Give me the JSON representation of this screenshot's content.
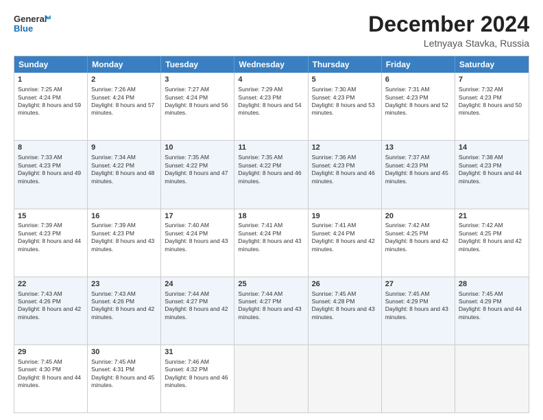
{
  "header": {
    "logo_line1": "General",
    "logo_line2": "Blue",
    "month": "December 2024",
    "location": "Letnyaya Stavka, Russia"
  },
  "weekdays": [
    "Sunday",
    "Monday",
    "Tuesday",
    "Wednesday",
    "Thursday",
    "Friday",
    "Saturday"
  ],
  "rows": [
    [
      {
        "day": "",
        "sunrise": "",
        "sunset": "",
        "daylight": "",
        "empty": true
      },
      {
        "day": "2",
        "sunrise": "Sunrise: 7:26 AM",
        "sunset": "Sunset: 4:24 PM",
        "daylight": "Daylight: 8 hours and 57 minutes."
      },
      {
        "day": "3",
        "sunrise": "Sunrise: 7:27 AM",
        "sunset": "Sunset: 4:24 PM",
        "daylight": "Daylight: 8 hours and 56 minutes."
      },
      {
        "day": "4",
        "sunrise": "Sunrise: 7:29 AM",
        "sunset": "Sunset: 4:23 PM",
        "daylight": "Daylight: 8 hours and 54 minutes."
      },
      {
        "day": "5",
        "sunrise": "Sunrise: 7:30 AM",
        "sunset": "Sunset: 4:23 PM",
        "daylight": "Daylight: 8 hours and 53 minutes."
      },
      {
        "day": "6",
        "sunrise": "Sunrise: 7:31 AM",
        "sunset": "Sunset: 4:23 PM",
        "daylight": "Daylight: 8 hours and 52 minutes."
      },
      {
        "day": "7",
        "sunrise": "Sunrise: 7:32 AM",
        "sunset": "Sunset: 4:23 PM",
        "daylight": "Daylight: 8 hours and 50 minutes."
      }
    ],
    [
      {
        "day": "1",
        "sunrise": "Sunrise: 7:25 AM",
        "sunset": "Sunset: 4:24 PM",
        "daylight": "Daylight: 8 hours and 59 minutes.",
        "first": true
      },
      {
        "day": "",
        "sunrise": "",
        "sunset": "",
        "daylight": "",
        "empty": true
      },
      {
        "day": "",
        "sunrise": "",
        "sunset": "",
        "daylight": "",
        "empty": true
      },
      {
        "day": "",
        "sunrise": "",
        "sunset": "",
        "daylight": "",
        "empty": true
      },
      {
        "day": "",
        "sunrise": "",
        "sunset": "",
        "daylight": "",
        "empty": true
      },
      {
        "day": "",
        "sunrise": "",
        "sunset": "",
        "daylight": "",
        "empty": true
      },
      {
        "day": "",
        "sunrise": "",
        "sunset": "",
        "daylight": "",
        "empty": true
      }
    ],
    [
      {
        "day": "8",
        "sunrise": "Sunrise: 7:33 AM",
        "sunset": "Sunset: 4:23 PM",
        "daylight": "Daylight: 8 hours and 49 minutes."
      },
      {
        "day": "9",
        "sunrise": "Sunrise: 7:34 AM",
        "sunset": "Sunset: 4:22 PM",
        "daylight": "Daylight: 8 hours and 48 minutes."
      },
      {
        "day": "10",
        "sunrise": "Sunrise: 7:35 AM",
        "sunset": "Sunset: 4:22 PM",
        "daylight": "Daylight: 8 hours and 47 minutes."
      },
      {
        "day": "11",
        "sunrise": "Sunrise: 7:35 AM",
        "sunset": "Sunset: 4:22 PM",
        "daylight": "Daylight: 8 hours and 46 minutes."
      },
      {
        "day": "12",
        "sunrise": "Sunrise: 7:36 AM",
        "sunset": "Sunset: 4:23 PM",
        "daylight": "Daylight: 8 hours and 46 minutes."
      },
      {
        "day": "13",
        "sunrise": "Sunrise: 7:37 AM",
        "sunset": "Sunset: 4:23 PM",
        "daylight": "Daylight: 8 hours and 45 minutes."
      },
      {
        "day": "14",
        "sunrise": "Sunrise: 7:38 AM",
        "sunset": "Sunset: 4:23 PM",
        "daylight": "Daylight: 8 hours and 44 minutes."
      }
    ],
    [
      {
        "day": "15",
        "sunrise": "Sunrise: 7:39 AM",
        "sunset": "Sunset: 4:23 PM",
        "daylight": "Daylight: 8 hours and 44 minutes."
      },
      {
        "day": "16",
        "sunrise": "Sunrise: 7:39 AM",
        "sunset": "Sunset: 4:23 PM",
        "daylight": "Daylight: 8 hours and 43 minutes."
      },
      {
        "day": "17",
        "sunrise": "Sunrise: 7:40 AM",
        "sunset": "Sunset: 4:24 PM",
        "daylight": "Daylight: 8 hours and 43 minutes."
      },
      {
        "day": "18",
        "sunrise": "Sunrise: 7:41 AM",
        "sunset": "Sunset: 4:24 PM",
        "daylight": "Daylight: 8 hours and 43 minutes."
      },
      {
        "day": "19",
        "sunrise": "Sunrise: 7:41 AM",
        "sunset": "Sunset: 4:24 PM",
        "daylight": "Daylight: 8 hours and 42 minutes."
      },
      {
        "day": "20",
        "sunrise": "Sunrise: 7:42 AM",
        "sunset": "Sunset: 4:25 PM",
        "daylight": "Daylight: 8 hours and 42 minutes."
      },
      {
        "day": "21",
        "sunrise": "Sunrise: 7:42 AM",
        "sunset": "Sunset: 4:25 PM",
        "daylight": "Daylight: 8 hours and 42 minutes."
      }
    ],
    [
      {
        "day": "22",
        "sunrise": "Sunrise: 7:43 AM",
        "sunset": "Sunset: 4:26 PM",
        "daylight": "Daylight: 8 hours and 42 minutes."
      },
      {
        "day": "23",
        "sunrise": "Sunrise: 7:43 AM",
        "sunset": "Sunset: 4:26 PM",
        "daylight": "Daylight: 8 hours and 42 minutes."
      },
      {
        "day": "24",
        "sunrise": "Sunrise: 7:44 AM",
        "sunset": "Sunset: 4:27 PM",
        "daylight": "Daylight: 8 hours and 42 minutes."
      },
      {
        "day": "25",
        "sunrise": "Sunrise: 7:44 AM",
        "sunset": "Sunset: 4:27 PM",
        "daylight": "Daylight: 8 hours and 43 minutes."
      },
      {
        "day": "26",
        "sunrise": "Sunrise: 7:45 AM",
        "sunset": "Sunset: 4:28 PM",
        "daylight": "Daylight: 8 hours and 43 minutes."
      },
      {
        "day": "27",
        "sunrise": "Sunrise: 7:45 AM",
        "sunset": "Sunset: 4:29 PM",
        "daylight": "Daylight: 8 hours and 43 minutes."
      },
      {
        "day": "28",
        "sunrise": "Sunrise: 7:45 AM",
        "sunset": "Sunset: 4:29 PM",
        "daylight": "Daylight: 8 hours and 44 minutes."
      }
    ],
    [
      {
        "day": "29",
        "sunrise": "Sunrise: 7:45 AM",
        "sunset": "Sunset: 4:30 PM",
        "daylight": "Daylight: 8 hours and 44 minutes."
      },
      {
        "day": "30",
        "sunrise": "Sunrise: 7:45 AM",
        "sunset": "Sunset: 4:31 PM",
        "daylight": "Daylight: 8 hours and 45 minutes."
      },
      {
        "day": "31",
        "sunrise": "Sunrise: 7:46 AM",
        "sunset": "Sunset: 4:32 PM",
        "daylight": "Daylight: 8 hours and 46 minutes."
      },
      {
        "day": "",
        "sunrise": "",
        "sunset": "",
        "daylight": "",
        "empty": true
      },
      {
        "day": "",
        "sunrise": "",
        "sunset": "",
        "daylight": "",
        "empty": true
      },
      {
        "day": "",
        "sunrise": "",
        "sunset": "",
        "daylight": "",
        "empty": true
      },
      {
        "day": "",
        "sunrise": "",
        "sunset": "",
        "daylight": "",
        "empty": true
      }
    ]
  ]
}
